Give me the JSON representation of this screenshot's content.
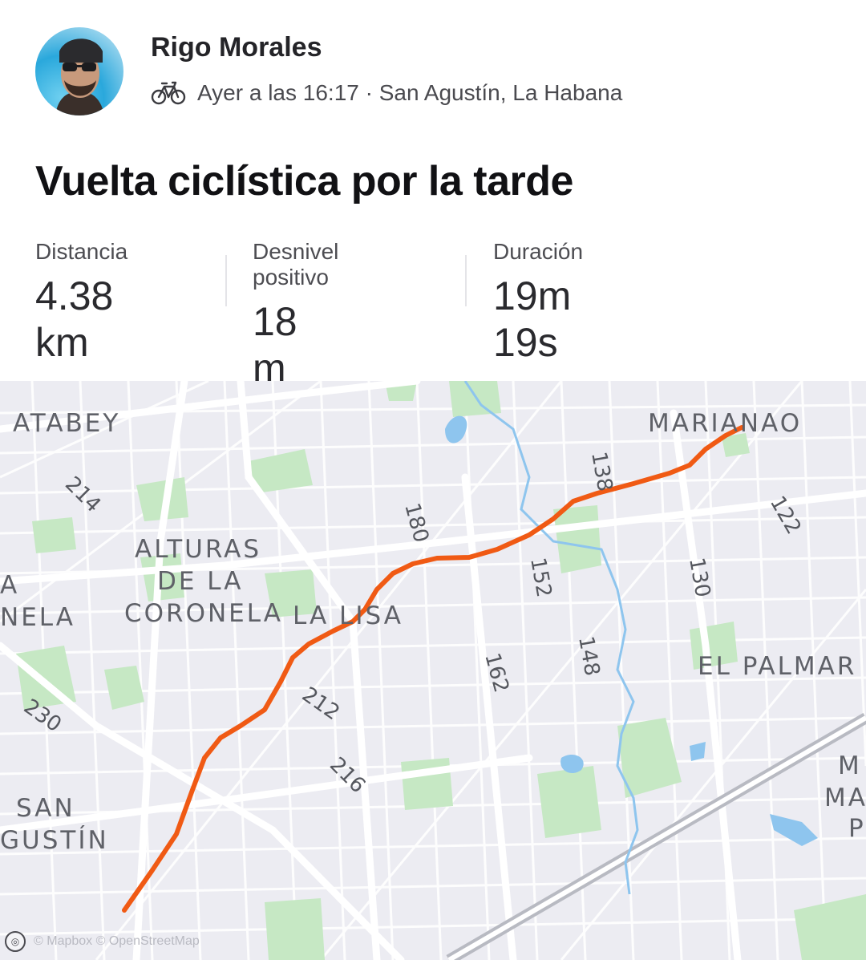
{
  "athlete": {
    "name": "Rigo Morales"
  },
  "activity": {
    "sport_icon": "bike-icon",
    "meta": "Ayer a las 16:17 · San Agustín, La Habana",
    "title": "Vuelta ciclística por la tarde"
  },
  "stats": [
    {
      "label": "Distancia",
      "value": "4.38 km"
    },
    {
      "label": "Desnivel positivo",
      "value": "18 m"
    },
    {
      "label": "Duración",
      "value": "19m 19s"
    }
  ],
  "map": {
    "route_color": "#f05a14",
    "water_color": "#8ec5ee",
    "park_color": "#c6e8c4",
    "area_labels": [
      "ATABEY",
      "ALTURAS",
      "DE LA",
      "CORONELA",
      "LA LISA",
      "MARIANAO",
      "EL PALMAR",
      "SAN",
      "GUSTÍN",
      "NELA",
      "A",
      "M",
      "MA",
      "P"
    ],
    "street_numbers": [
      "214",
      "180",
      "138",
      "122",
      "152",
      "130",
      "148",
      "162",
      "212",
      "216",
      "230"
    ],
    "attribution": "© Mapbox © OpenStreetMap"
  }
}
